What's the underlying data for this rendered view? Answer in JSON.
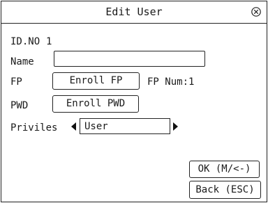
{
  "dialog": {
    "title": "Edit User"
  },
  "id": {
    "label": "ID.NO",
    "value": "1"
  },
  "name": {
    "label": "Name",
    "value": ""
  },
  "fp": {
    "label": "FP",
    "enroll_label": "Enroll FP",
    "num_text": "FP Num:1"
  },
  "pwd": {
    "label": "PWD",
    "enroll_label": "Enroll PWD"
  },
  "privilege": {
    "label": "Privilеs",
    "selected": "User"
  },
  "actions": {
    "ok_label": "OK (M/<-)",
    "back_label": "Back (ESC)"
  },
  "icons": {
    "close": "close-circle-icon",
    "prev": "triangle-left-icon",
    "next": "triangle-right-icon"
  }
}
